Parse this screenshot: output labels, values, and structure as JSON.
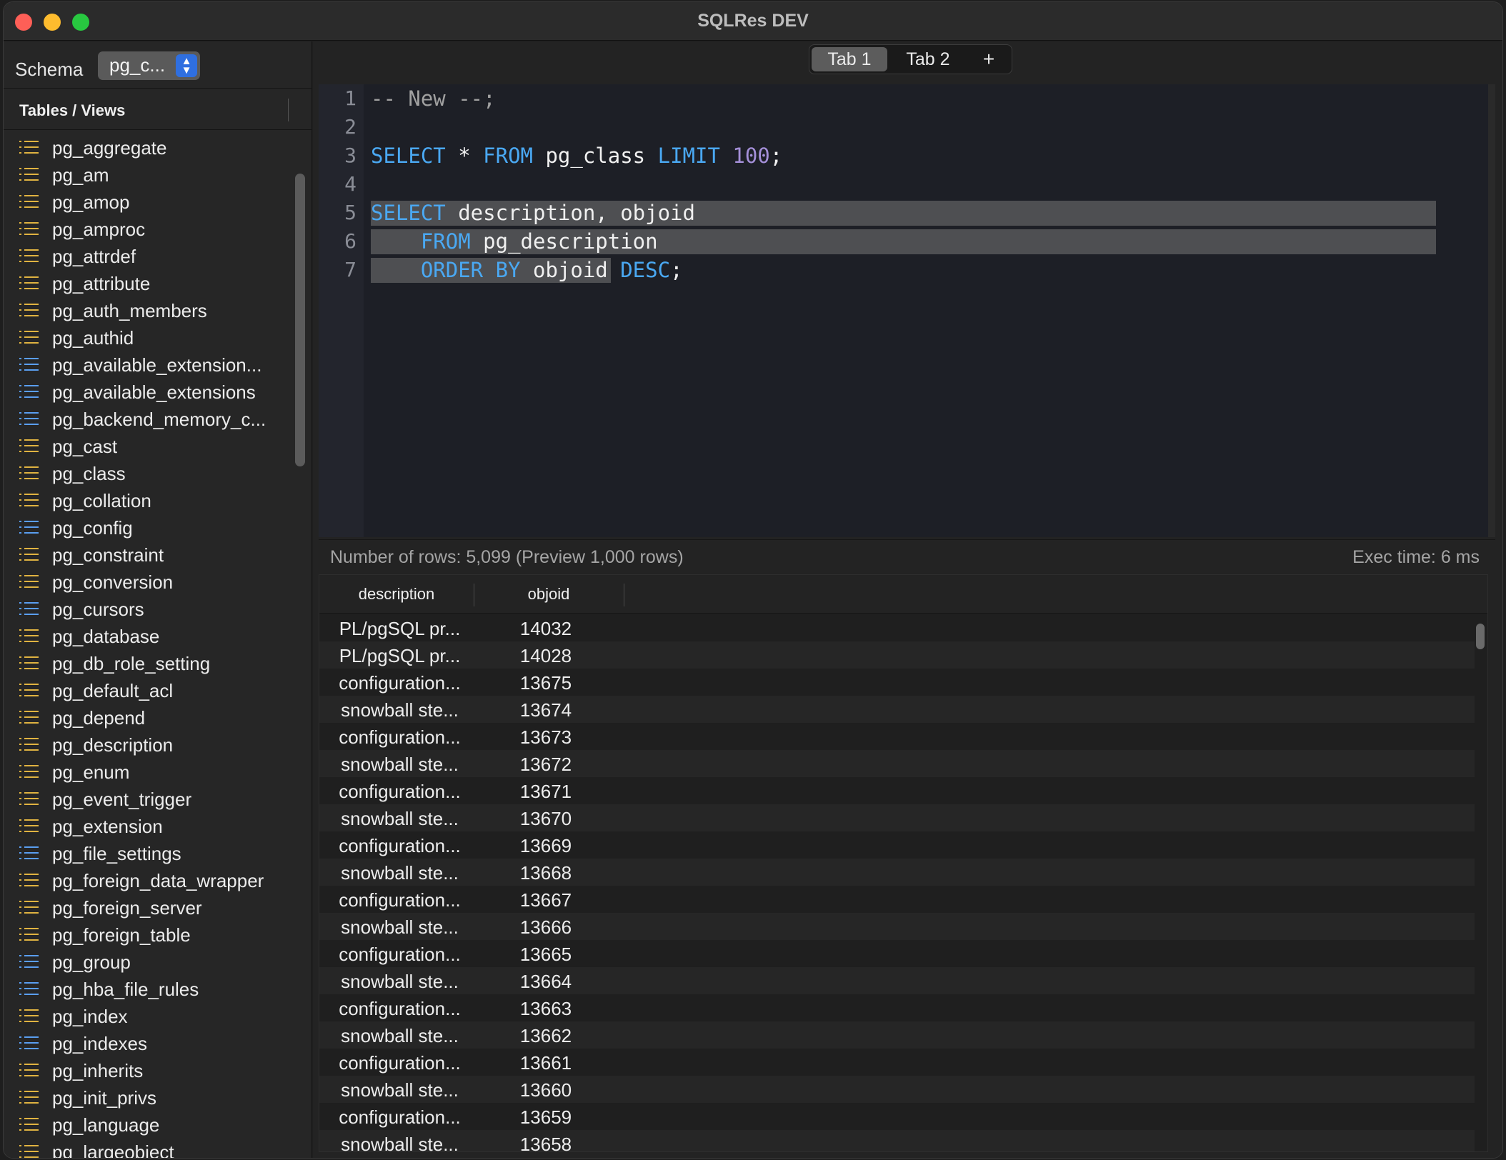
{
  "window": {
    "title": "SQLRes DEV"
  },
  "sidebar": {
    "schema_label": "Schema",
    "schema_value": "pg_c...",
    "tables_header": "Tables / Views",
    "items": [
      {
        "name": "pg_aggregate",
        "kind": "table"
      },
      {
        "name": "pg_am",
        "kind": "table"
      },
      {
        "name": "pg_amop",
        "kind": "table"
      },
      {
        "name": "pg_amproc",
        "kind": "table"
      },
      {
        "name": "pg_attrdef",
        "kind": "table"
      },
      {
        "name": "pg_attribute",
        "kind": "table"
      },
      {
        "name": "pg_auth_members",
        "kind": "table"
      },
      {
        "name": "pg_authid",
        "kind": "table"
      },
      {
        "name": "pg_available_extension...",
        "kind": "view"
      },
      {
        "name": "pg_available_extensions",
        "kind": "view"
      },
      {
        "name": "pg_backend_memory_c...",
        "kind": "view"
      },
      {
        "name": "pg_cast",
        "kind": "table"
      },
      {
        "name": "pg_class",
        "kind": "table"
      },
      {
        "name": "pg_collation",
        "kind": "table"
      },
      {
        "name": "pg_config",
        "kind": "view"
      },
      {
        "name": "pg_constraint",
        "kind": "table"
      },
      {
        "name": "pg_conversion",
        "kind": "table"
      },
      {
        "name": "pg_cursors",
        "kind": "view"
      },
      {
        "name": "pg_database",
        "kind": "table"
      },
      {
        "name": "pg_db_role_setting",
        "kind": "table"
      },
      {
        "name": "pg_default_acl",
        "kind": "table"
      },
      {
        "name": "pg_depend",
        "kind": "table"
      },
      {
        "name": "pg_description",
        "kind": "table"
      },
      {
        "name": "pg_enum",
        "kind": "table"
      },
      {
        "name": "pg_event_trigger",
        "kind": "table"
      },
      {
        "name": "pg_extension",
        "kind": "table"
      },
      {
        "name": "pg_file_settings",
        "kind": "view"
      },
      {
        "name": "pg_foreign_data_wrapper",
        "kind": "table"
      },
      {
        "name": "pg_foreign_server",
        "kind": "table"
      },
      {
        "name": "pg_foreign_table",
        "kind": "table"
      },
      {
        "name": "pg_group",
        "kind": "view"
      },
      {
        "name": "pg_hba_file_rules",
        "kind": "view"
      },
      {
        "name": "pg_index",
        "kind": "table"
      },
      {
        "name": "pg_indexes",
        "kind": "view"
      },
      {
        "name": "pg_inherits",
        "kind": "table"
      },
      {
        "name": "pg_init_privs",
        "kind": "table"
      },
      {
        "name": "pg_language",
        "kind": "table"
      },
      {
        "name": "pg_largeobject",
        "kind": "table"
      }
    ]
  },
  "tabs": [
    {
      "label": "Tab 1",
      "active": true
    },
    {
      "label": "Tab 2",
      "active": false
    }
  ],
  "new_tab_label": "+",
  "editor": {
    "line_numbers": [
      "1",
      "2",
      "3",
      "4",
      "5",
      "6",
      "7"
    ]
  },
  "status": {
    "rows_text": "Number of rows: 5,099 (Preview 1,000 rows)",
    "exec_text": "Exec time: 6 ms"
  },
  "results": {
    "columns": [
      "description",
      "objoid"
    ],
    "rows": [
      [
        "PL/pgSQL pr...",
        "14032"
      ],
      [
        "PL/pgSQL pr...",
        "14028"
      ],
      [
        "configuration...",
        "13675"
      ],
      [
        "snowball ste...",
        "13674"
      ],
      [
        "configuration...",
        "13673"
      ],
      [
        "snowball ste...",
        "13672"
      ],
      [
        "configuration...",
        "13671"
      ],
      [
        "snowball ste...",
        "13670"
      ],
      [
        "configuration...",
        "13669"
      ],
      [
        "snowball ste...",
        "13668"
      ],
      [
        "configuration...",
        "13667"
      ],
      [
        "snowball ste...",
        "13666"
      ],
      [
        "configuration...",
        "13665"
      ],
      [
        "snowball ste...",
        "13664"
      ],
      [
        "configuration...",
        "13663"
      ],
      [
        "snowball ste...",
        "13662"
      ],
      [
        "configuration...",
        "13661"
      ],
      [
        "snowball ste...",
        "13660"
      ],
      [
        "configuration...",
        "13659"
      ],
      [
        "snowball ste...",
        "13658"
      ]
    ]
  },
  "colors": {
    "keyword": "#4aa8f2",
    "number": "#a48fd8",
    "table_icon": "#e0b341",
    "view_icon": "#5a9ef0",
    "accent": "#2f6fe0"
  }
}
